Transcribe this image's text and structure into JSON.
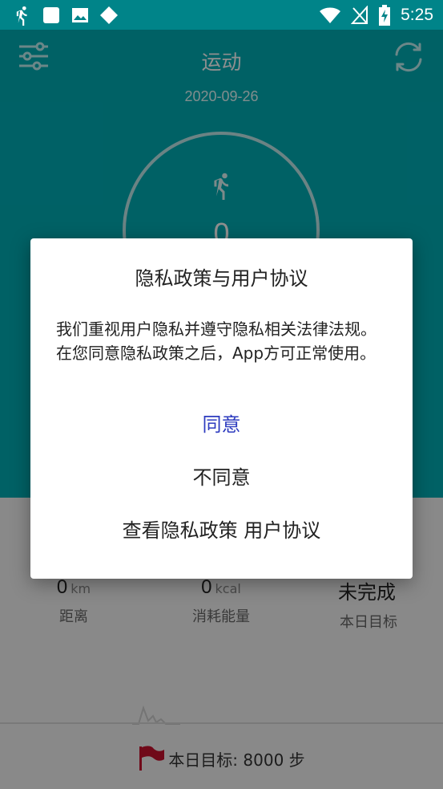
{
  "status_bar": {
    "time": "5:25",
    "icons": [
      "running-icon",
      "square-icon",
      "image-icon",
      "diamond-icon",
      "wifi-icon",
      "no-signal-icon",
      "battery-charging-icon"
    ]
  },
  "header": {
    "title": "运动",
    "date": "2020-09-26",
    "left_icon": "sliders-icon",
    "right_icon": "sync-icon"
  },
  "progress": {
    "icon": "running-icon",
    "steps": "0"
  },
  "stats": [
    {
      "value": "0",
      "unit": "km",
      "label": "距离"
    },
    {
      "value": "0",
      "unit": "kcal",
      "label": "消耗能量"
    },
    {
      "value": "未完成",
      "unit": "",
      "label": "本日目标"
    }
  ],
  "goal": {
    "icon": "flag-icon",
    "text": "本日目标: 8000 步",
    "color": "#c8102e"
  },
  "dialog": {
    "title": "隐私政策与用户协议",
    "body": "我们重视用户隐私并遵守隐私相关法律法规。 在您同意隐私政策之后，App方可正常使用。",
    "agree_label": "同意",
    "disagree_label": "不同意",
    "view_policy_label": "查看隐私政策 用户协议",
    "accent_color": "#2d3bbf"
  },
  "colors": {
    "primary": "#00adb5",
    "status_bar": "#008489"
  }
}
